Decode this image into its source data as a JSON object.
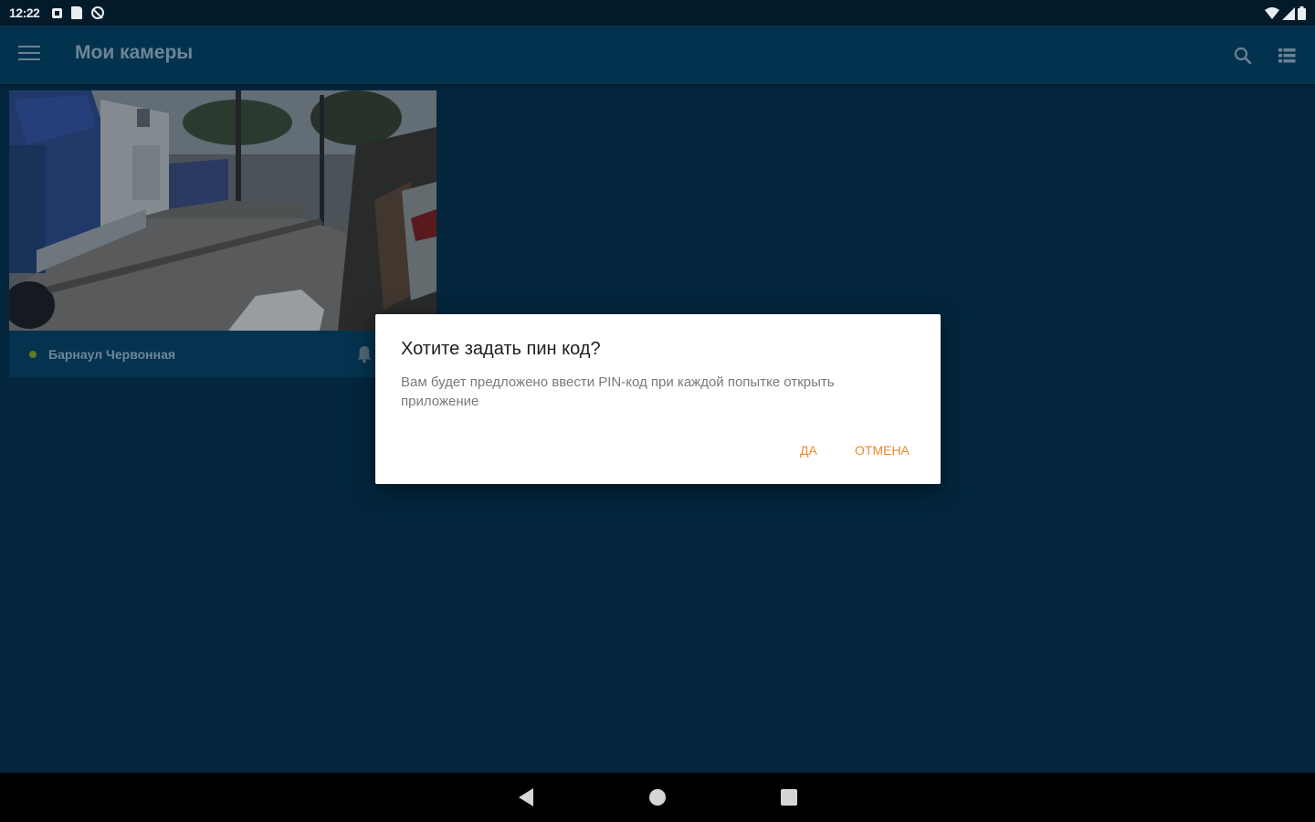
{
  "status_bar": {
    "time": "12:22",
    "left_icons": [
      "notification-icon",
      "sd-card-icon",
      "vpn-icon"
    ],
    "right_icons": [
      "wifi-icon",
      "signal-icon",
      "battery-icon"
    ]
  },
  "app_bar": {
    "title": "Мои камеры",
    "menu_icon": "hamburger-menu-icon",
    "actions": [
      "search-icon",
      "list-view-icon"
    ]
  },
  "camera_card": {
    "name": "Барнаул Червонная",
    "status": "online",
    "status_color": "#627b21",
    "bell_icon": "bell-icon"
  },
  "dialog": {
    "title": "Хотите задать пин код?",
    "message": "Вам будет предложено ввести PIN-код при каждой попытке открыть приложение",
    "yes_label": "ДА",
    "cancel_label": "ОТМЕНА"
  },
  "colors": {
    "background": "#03263d",
    "app_bar": "#03324e",
    "accent": "#f08a2b"
  },
  "nav_bar": {
    "buttons": [
      "back-icon",
      "home-icon",
      "recents-icon"
    ]
  }
}
